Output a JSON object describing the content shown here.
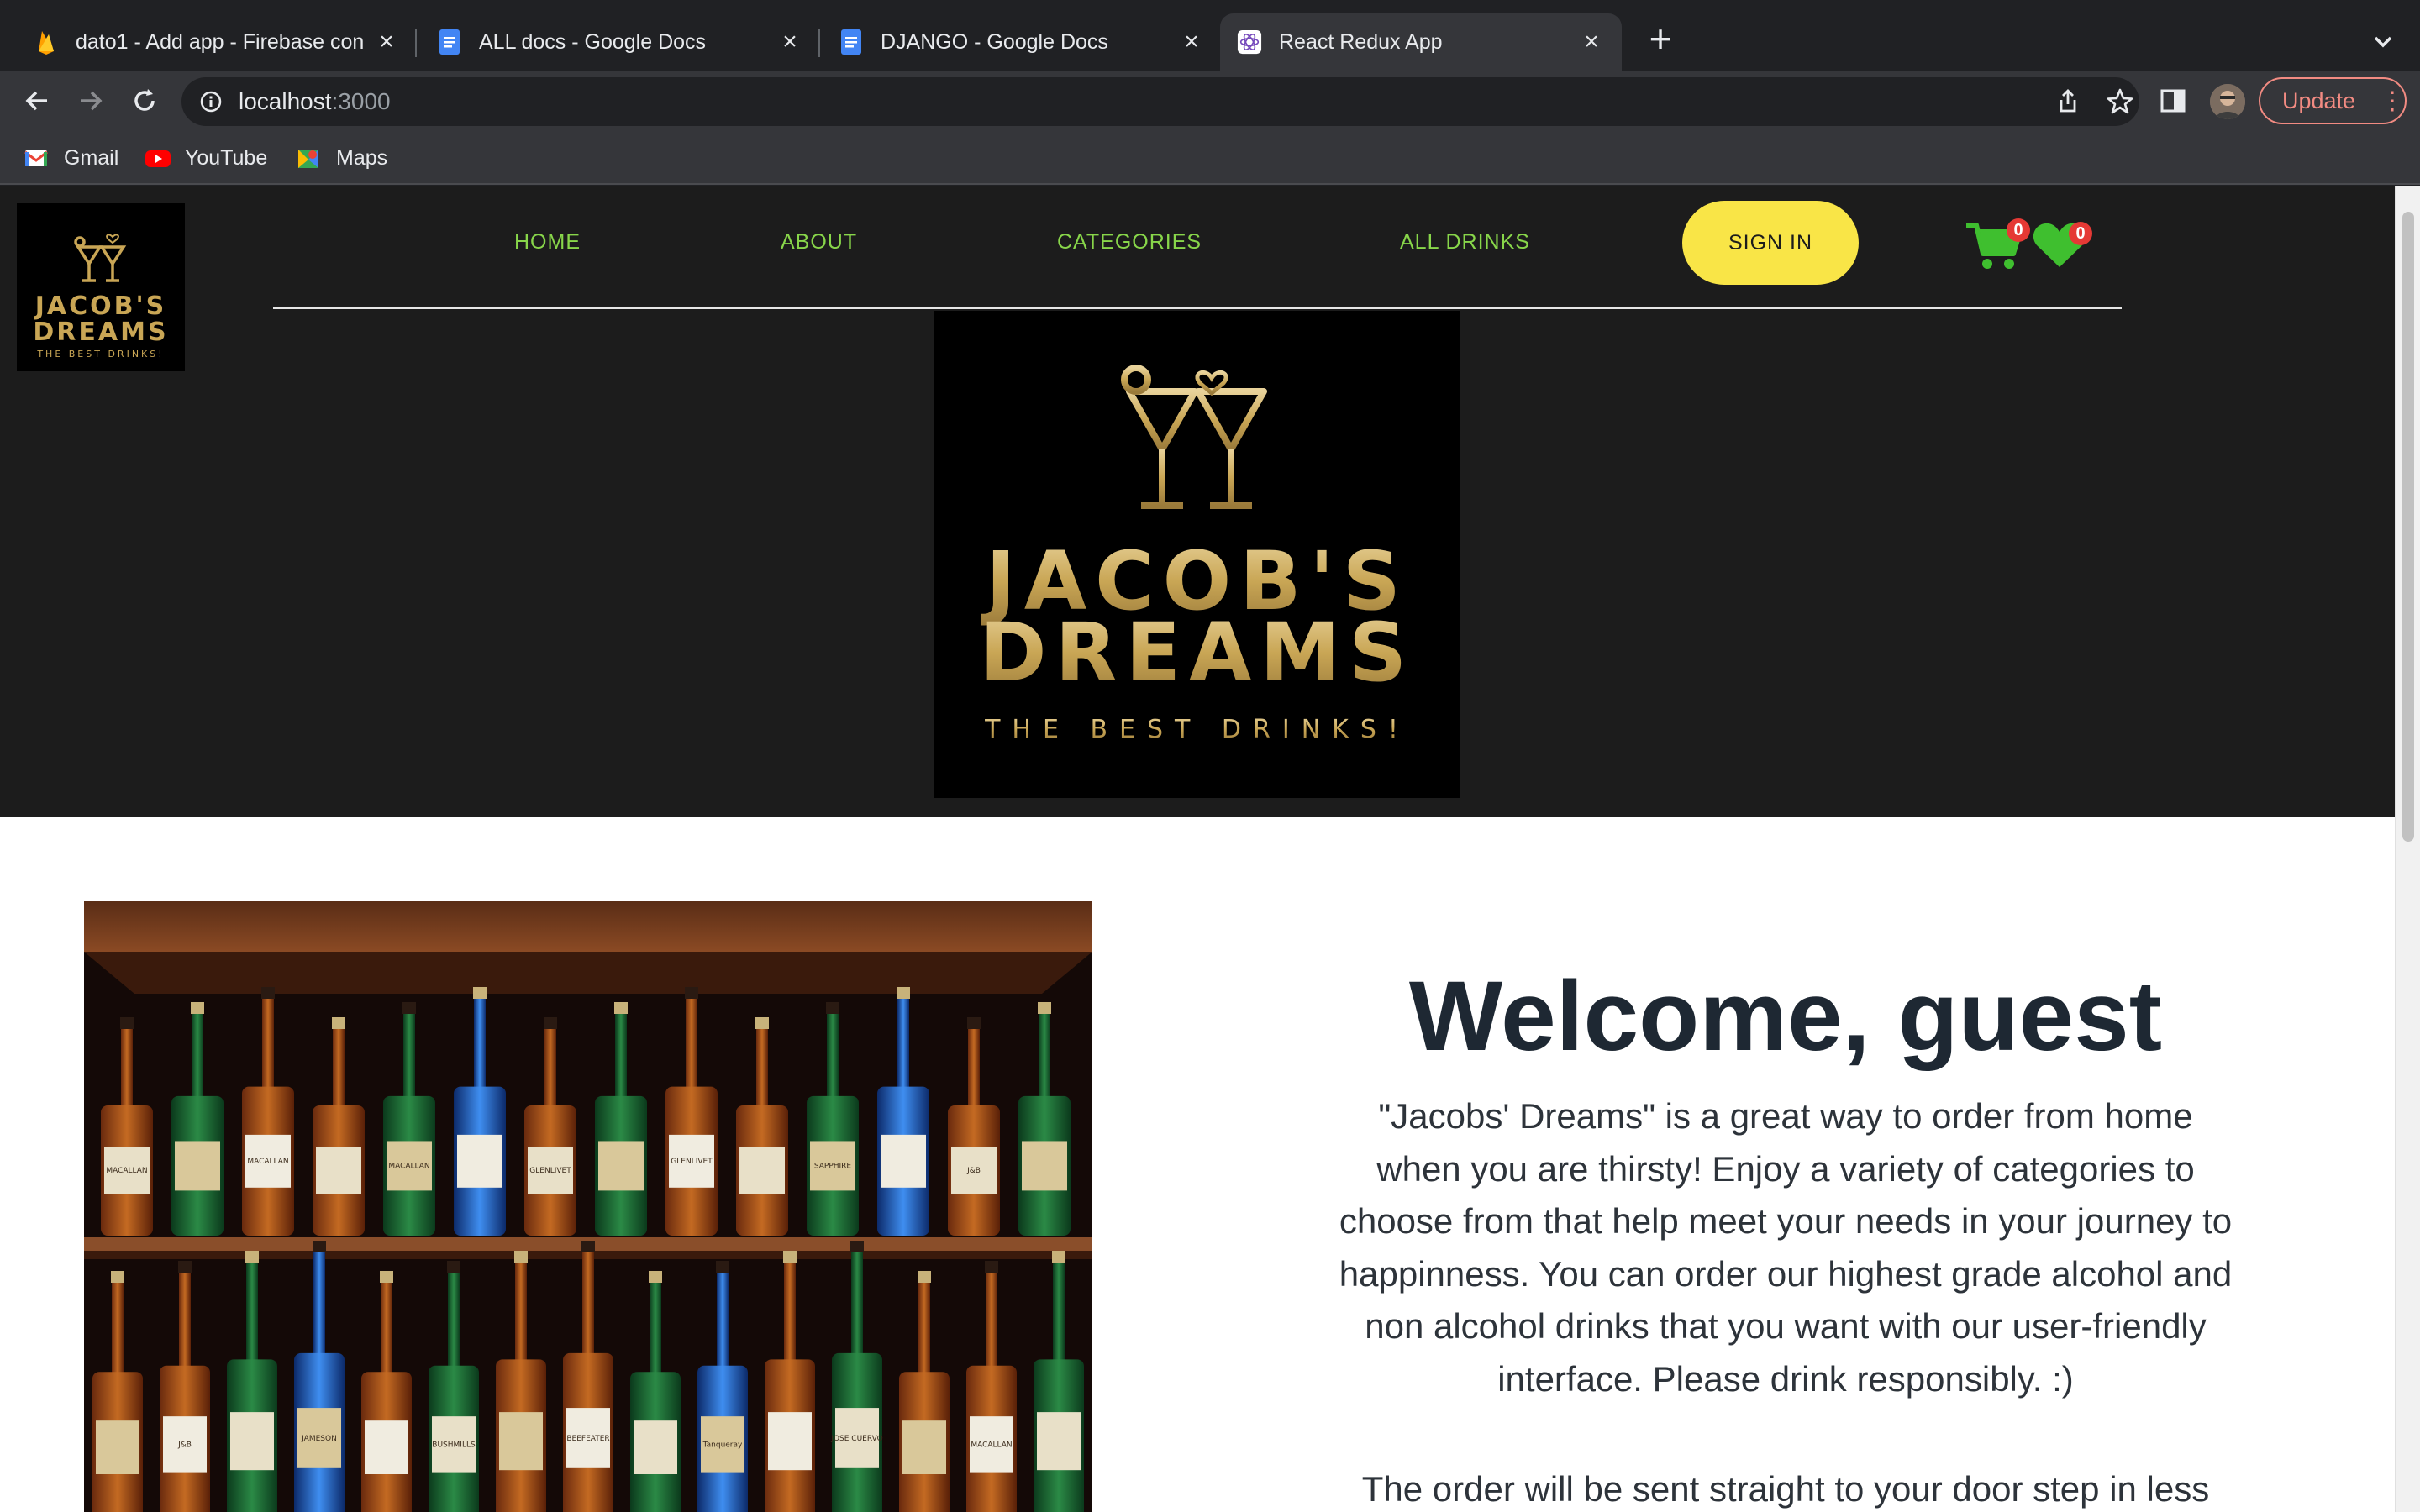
{
  "browser": {
    "tabs": [
      {
        "title": "dato1 - Add app - Firebase con",
        "favicon": "firebase-icon",
        "active": false
      },
      {
        "title": "ALL docs - Google Docs",
        "favicon": "google-docs-icon",
        "active": false
      },
      {
        "title": "DJANGO - Google Docs",
        "favicon": "google-docs-icon",
        "active": false
      },
      {
        "title": "React Redux App",
        "favicon": "react-icon",
        "active": true
      }
    ],
    "address": {
      "host": "localhost",
      "port": ":3000"
    },
    "update_label": "Update",
    "bookmarks": [
      {
        "label": "Gmail",
        "icon": "gmail-icon"
      },
      {
        "label": "YouTube",
        "icon": "youtube-icon"
      },
      {
        "label": "Maps",
        "icon": "maps-icon"
      }
    ]
  },
  "site": {
    "logo_small": {
      "line1": "JACOB'S",
      "line2": "DREAMS",
      "tagline": "THE BEST DRINKS!"
    },
    "nav": [
      "HOME",
      "ABOUT",
      "CATEGORIES",
      "ALL DRINKS"
    ],
    "signin_label": "SIGN IN",
    "cart_count": "0",
    "wishlist_count": "0",
    "logo_big": {
      "line1": "JACOB'S",
      "line2": "DREAMS",
      "tagline": "THE BEST DRINKS!"
    },
    "accent_green": "#88d64a",
    "accent_yellow": "#f9e547"
  },
  "hero": {
    "welcome": "Welcome, guest",
    "intro_lines": [
      "\"Jacobs' Dreams\" is a great way to order from home",
      "when you are thirsty! Enjoy a variety of categories to",
      "choose from that help meet your needs in your journey to",
      "happinness. You can order our highest grade alcohol and",
      "non alcohol drinks that you want with our user-friendly",
      "interface. Please drink responsibly. :)"
    ],
    "intro2": "The order will be sent straight to your door step in less",
    "bottle_labels": [
      "MACALLAN",
      "MACALLAN",
      "MACALLAN",
      "GLENLIVET",
      "GLENLIVET",
      "SAPPHIRE",
      "J&B",
      "J&B",
      "JAMESON",
      "BUSHMILLS",
      "BEEFEATER",
      "Tanqueray",
      "JOSE CUERVO"
    ]
  }
}
